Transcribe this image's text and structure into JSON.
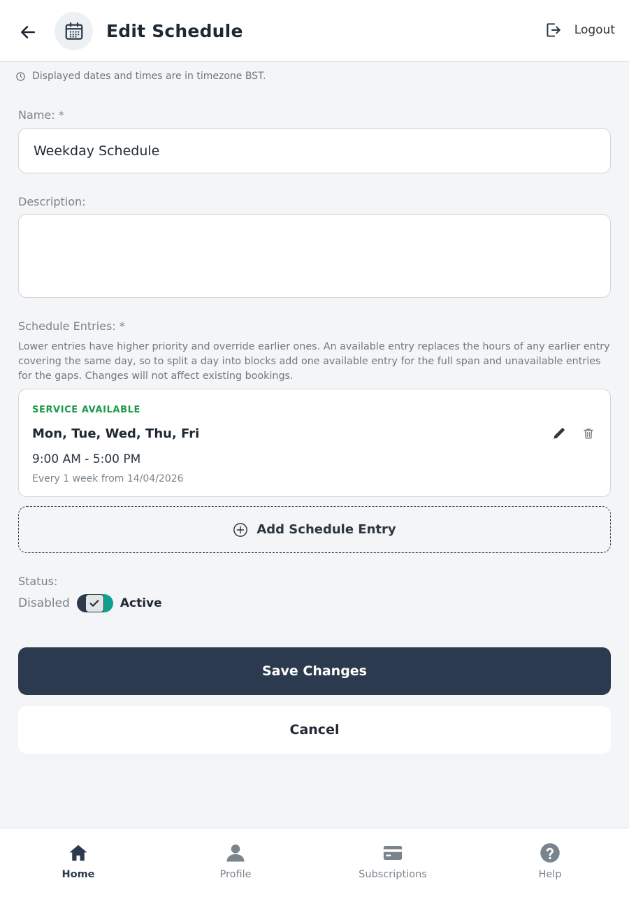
{
  "header": {
    "title": "Edit Schedule",
    "logout_label": "Logout"
  },
  "timezone_note": "Displayed dates and times are in timezone BST.",
  "form": {
    "name_label": "Name: *",
    "name_value": "Weekday Schedule",
    "description_label": "Description:",
    "description_value": "",
    "entries_label": "Schedule Entries: *",
    "entries_help": "Lower entries have higher priority and override earlier ones. An available entry replaces the hours of any earlier entry covering the same day, so to split a day into blocks add one available entry for the full span and unavailable entries for the gaps. Changes will not affect existing bookings."
  },
  "entries": [
    {
      "badge": "SERVICE AVAILABLE",
      "days": "Mon, Tue, Wed, Thu, Fri",
      "time": "9:00 AM - 5:00 PM",
      "recurrence": "Every 1 week from 14/04/2026"
    }
  ],
  "add_entry_label": "Add Schedule Entry",
  "status": {
    "label": "Status:",
    "off_label": "Disabled",
    "on_label": "Active",
    "active": true
  },
  "actions": {
    "save_label": "Save Changes",
    "cancel_label": "Cancel"
  },
  "nav": {
    "items": [
      {
        "label": "Home",
        "icon": "home-icon",
        "active": true
      },
      {
        "label": "Profile",
        "icon": "person-icon",
        "active": false
      },
      {
        "label": "Subscriptions",
        "icon": "card-icon",
        "active": false
      },
      {
        "label": "Help",
        "icon": "help-icon",
        "active": false
      }
    ]
  },
  "colors": {
    "primary": "#2b3a4e",
    "available_green": "#1e9a4c",
    "toggle_on": "#0f9f8f",
    "background": "#f3f5f6"
  }
}
